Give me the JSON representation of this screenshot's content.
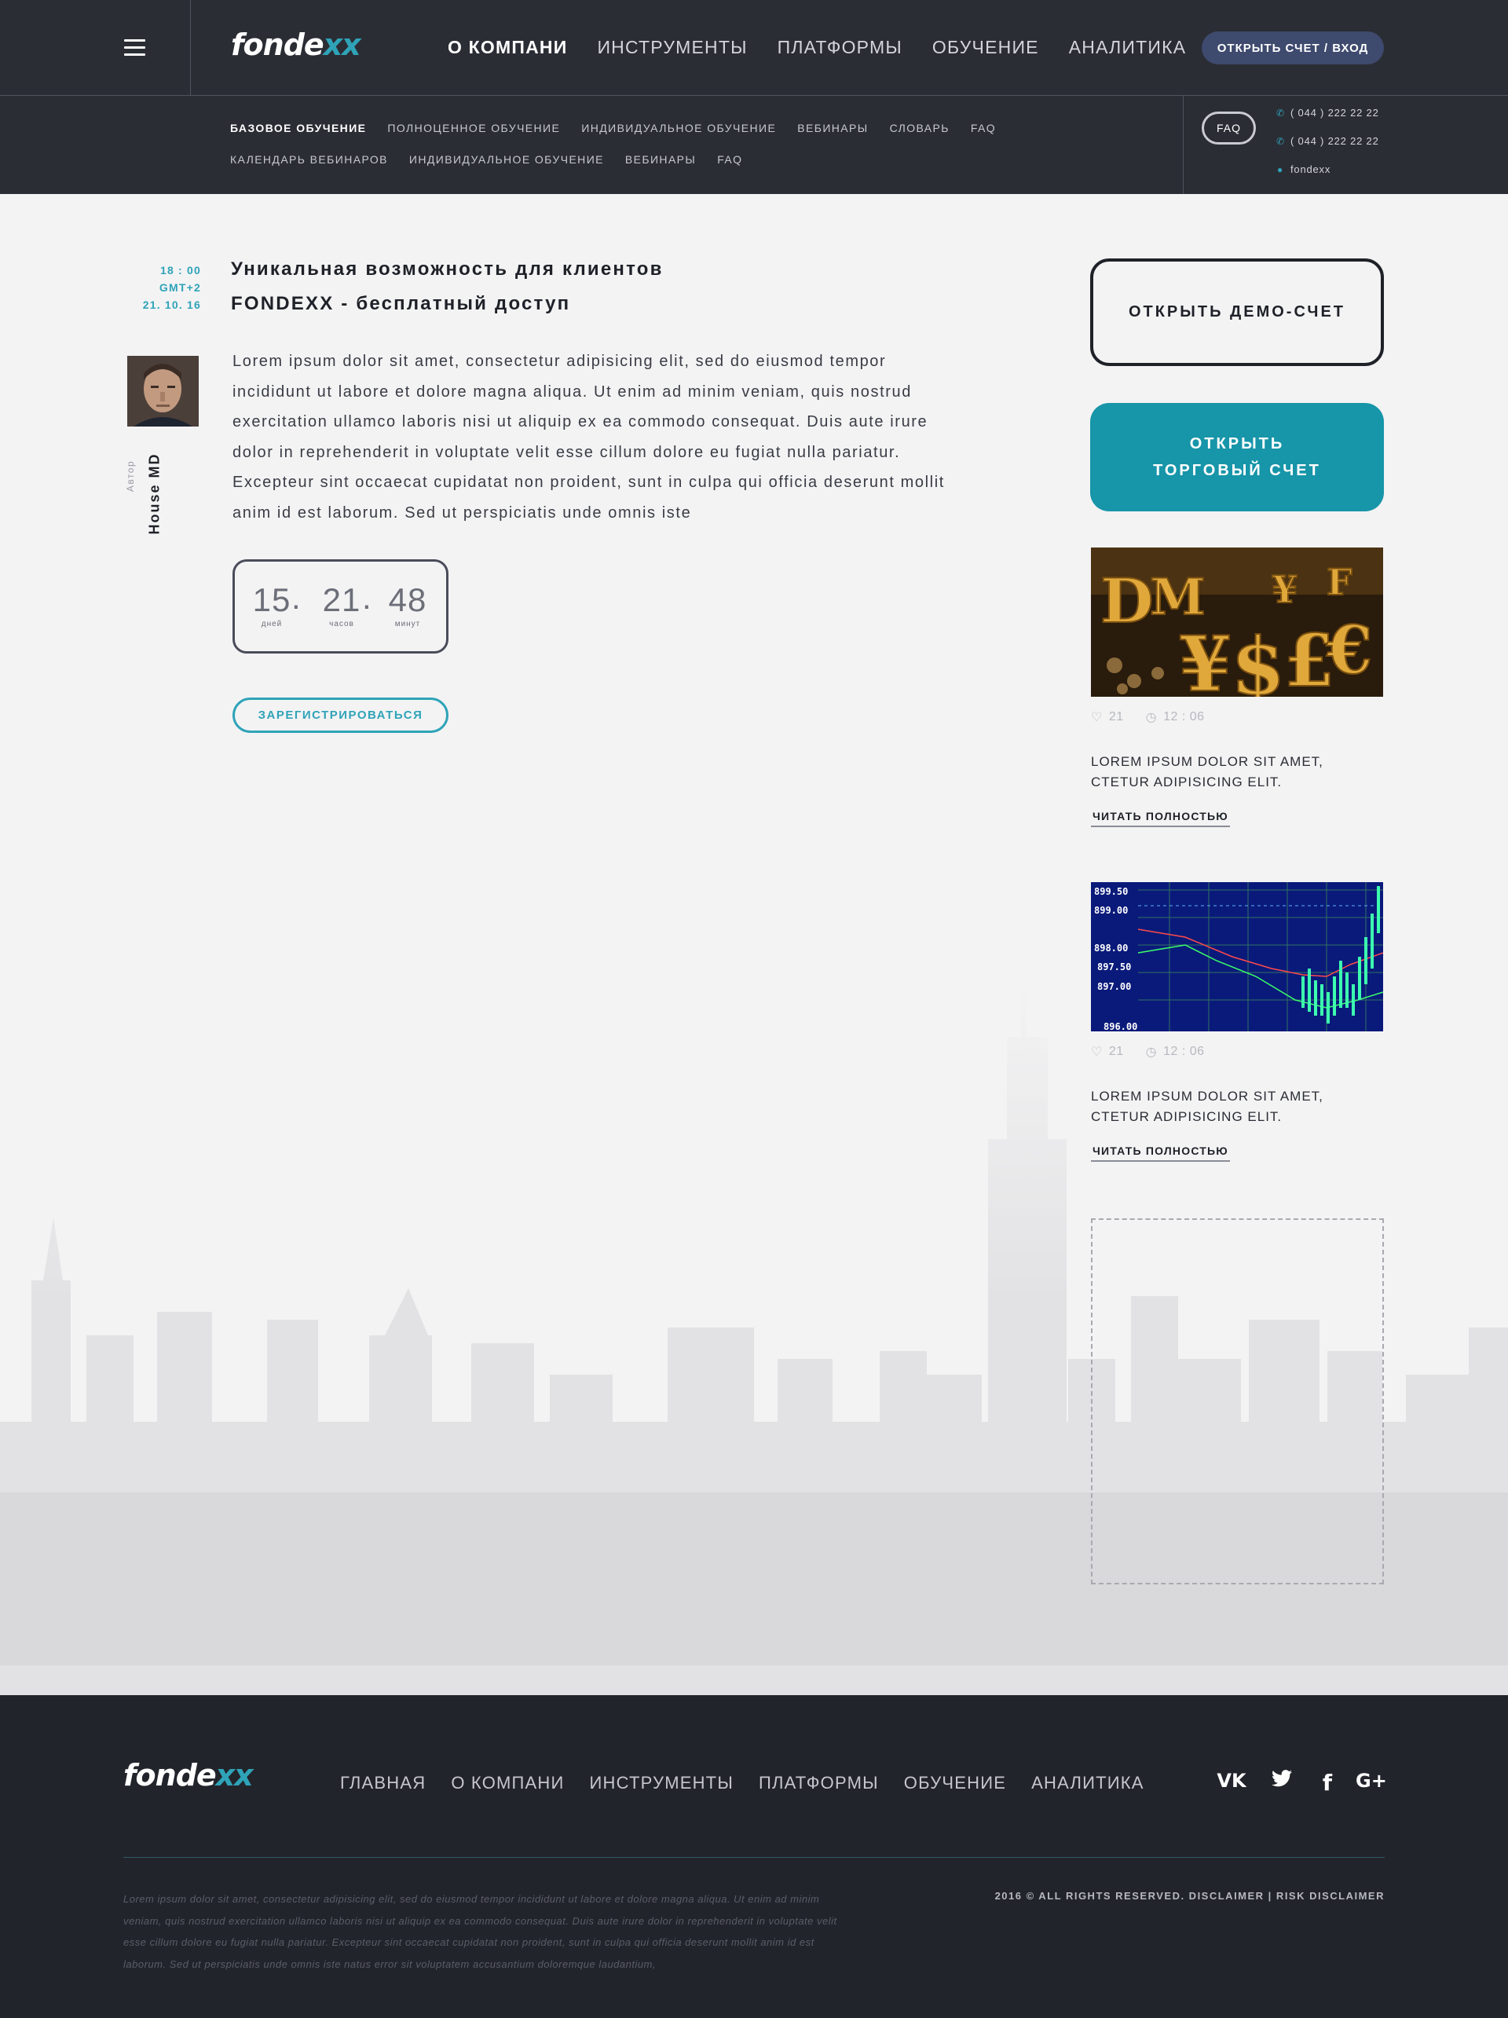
{
  "brand": {
    "name_main": "fonde",
    "name_accent": "xx"
  },
  "header": {
    "menu_icon": "hamburger-menu-icon",
    "nav": [
      {
        "label": "О КОМПАНИ",
        "active": true
      },
      {
        "label": "ИНСТРУМЕНТЫ",
        "active": false
      },
      {
        "label": "ПЛАТФОРМЫ",
        "active": false
      },
      {
        "label": "ОБУЧЕНИЕ",
        "active": false
      },
      {
        "label": "АНАЛИТИКА",
        "active": false
      }
    ],
    "login_label": "ОТКРЫТЬ СЧЕТ / ВХОД"
  },
  "subnav": {
    "items": [
      {
        "label": "БАЗОВОЕ ОБУЧЕНИЕ",
        "active": true
      },
      {
        "label": "ПОЛНОЦЕННОЕ ОБУЧЕНИЕ",
        "active": false
      },
      {
        "label": "ИНДИВИДУАЛЬНОЕ ОБУЧЕНИЕ",
        "active": false
      },
      {
        "label": "ВЕБИНАРЫ",
        "active": false
      },
      {
        "label": "СЛОВАРЬ",
        "active": false
      },
      {
        "label": "FAQ",
        "active": false
      },
      {
        "label": "КАЛЕНДАРЬ ВЕБИНАРОВ",
        "active": false
      },
      {
        "label": "ИНДИВИДУАЛЬНОЕ ОБУЧЕНИЕ",
        "active": false
      },
      {
        "label": "ВЕБИНАРЫ",
        "active": false
      },
      {
        "label": "FAQ",
        "active": false
      }
    ],
    "faq_label": "FAQ",
    "contacts": [
      {
        "icon": "phone-icon",
        "text": "( 044 ) 222 22 22"
      },
      {
        "icon": "phone-icon",
        "text": "( 044 ) 222 22 22"
      },
      {
        "icon": "skype-icon",
        "text": "fondexx"
      }
    ]
  },
  "event": {
    "time": "18 : 00",
    "timezone": "GMT+2",
    "date": "21. 10. 16",
    "title_line1": "Уникальная возможность для клиентов",
    "title_line2": "FONDEXX - бесплатный доступ",
    "author_label": "Автор",
    "author_name": "House MD",
    "body": "Lorem ipsum dolor sit amet, consectetur adipisicing elit, sed do eiusmod tempor incididunt ut labore et dolore magna aliqua. Ut enim ad minim veniam, quis nostrud exercitation ullamco laboris nisi ut aliquip ex ea commodo consequat. Duis aute irure dolor in reprehenderit in voluptate velit esse cillum dolore eu fugiat nulla pariatur. Excepteur sint occaecat cupidatat non proident, sunt in culpa qui officia deserunt mollit anim id est laborum. Sed ut perspiciatis unde omnis iste",
    "countdown": {
      "days": "15",
      "days_label": "дней",
      "hours": "21",
      "hours_label": "часов",
      "minutes": "48",
      "minutes_label": "минут"
    },
    "register_label": "ЗАРЕГИСТРИРОВАТЬСЯ"
  },
  "sidebar": {
    "demo_label": "ОТКРЫТЬ ДЕМО-СЧЕТ",
    "trade_line1": "ОТКРЫТЬ",
    "trade_line2": "ТОРГОВЫЙ СЧЕТ",
    "cards": [
      {
        "image": "currency-symbols-photo",
        "likes": "21",
        "time": "12 : 06",
        "title": "LOREM IPSUM DOLOR SIT AMET, CTETUR ADIPISICING ELIT.",
        "link": "ЧИТАТЬ ПОЛНОСТЬЮ"
      },
      {
        "image": "trading-chart-photo",
        "likes": "21",
        "time": "12 : 06",
        "title": "LOREM IPSUM DOLOR SIT AMET, CTETUR ADIPISICING ELIT.",
        "link": "ЧИТАТЬ ПОЛНОСТЬЮ"
      }
    ],
    "chart_ticks": [
      "899.50",
      "899.00",
      "898.00",
      "897.50",
      "897.00",
      "896.00"
    ]
  },
  "footer": {
    "nav": [
      "ГЛАВНАЯ",
      "О КОМПАНИ",
      "ИНСТРУМЕНТЫ",
      "ПЛАТФОРМЫ",
      "ОБУЧЕНИЕ",
      "АНАЛИТИКА"
    ],
    "social": [
      {
        "name": "vk-icon",
        "glyph": "VK"
      },
      {
        "name": "twitter-icon",
        "glyph": "🐦"
      },
      {
        "name": "facebook-icon",
        "glyph": "f"
      },
      {
        "name": "google-plus-icon",
        "glyph": "G+"
      }
    ],
    "text": "Lorem ipsum dolor sit amet, consectetur adipisicing elit, sed do eiusmod tempor incididunt ut labore et dolore magna aliqua. Ut enim ad minim veniam, quis nostrud exercitation ullamco laboris nisi ut aliquip ex ea commodo consequat. Duis aute irure dolor in reprehenderit in voluptate velit esse cillum dolore eu fugiat nulla pariatur. Excepteur sint occaecat cupidatat non proident, sunt in culpa qui officia deserunt mollit anim id est laborum. Sed ut perspiciatis unde omnis iste natus error sit voluptatem accusantium doloremque laudantium,",
    "copyright": "2016 © ALL RIGHTS RESERVED. DISCLAIMER | RISK DISCLAIMER"
  },
  "colors": {
    "header_bg": "#2b2d35",
    "accent": "#2fa3b8",
    "trade_button": "#1795a9",
    "login_button": "#3e4a6e",
    "footer_bg": "#22242b"
  }
}
